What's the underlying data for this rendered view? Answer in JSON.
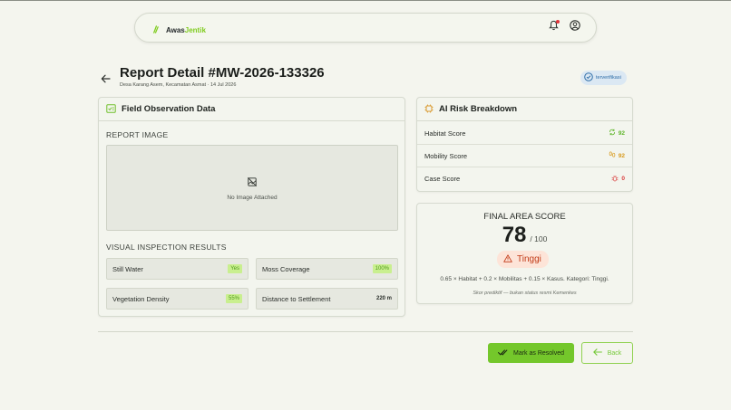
{
  "navbar": {
    "brand_prefix": "Awas",
    "brand_accent": "Jentik",
    "has_notification": true
  },
  "header": {
    "title": "Report Detail #MW-2026-133326",
    "subtitle": "Desa Karang Asem, Kecamatan Asmat · 14 Jul 2026",
    "verified_label": "terverifikasi"
  },
  "field_observation": {
    "title": "Field Observation Data",
    "report_image_label": "REPORT IMAGE",
    "no_image_text": "No Image Attached",
    "inspection_label": "VISUAL INSPECTION RESULTS",
    "inspections": [
      {
        "label": "Still Water",
        "value": "Yes"
      },
      {
        "label": "Moss Coverage",
        "value": "100%"
      },
      {
        "label": "Vegetation Density",
        "value": "55%"
      },
      {
        "label": "Distance to Settlement",
        "value": "220 m"
      }
    ]
  },
  "risk": {
    "title": "AI Risk Breakdown",
    "rows": [
      {
        "label": "Habitat Score",
        "value": "92",
        "icon": "recycle-icon",
        "color": "#5fb52a"
      },
      {
        "label": "Mobility Score",
        "value": "92",
        "icon": "footprints-icon",
        "color": "#d89a1e"
      },
      {
        "label": "Case Score",
        "value": "0",
        "icon": "bug-icon",
        "color": "#d93a3a"
      }
    ]
  },
  "final_score": {
    "label": "FINAL AREA SCORE",
    "value": "78",
    "max": "/ 100",
    "level": "Tinggi",
    "formula": "0.65 × Habitat + 0.2 × Mobilitas + 0.15 × Kasus. Kategori: Tinggi.",
    "disclaimer": "Skor prediktif — bukan status resmi Kemenkes"
  },
  "actions": {
    "resolve_label": "Mark as Resolved",
    "back_label": "Back"
  },
  "colors": {
    "accent": "#74c72b",
    "danger": "#c23b17",
    "verified": "#2f6ea8"
  }
}
